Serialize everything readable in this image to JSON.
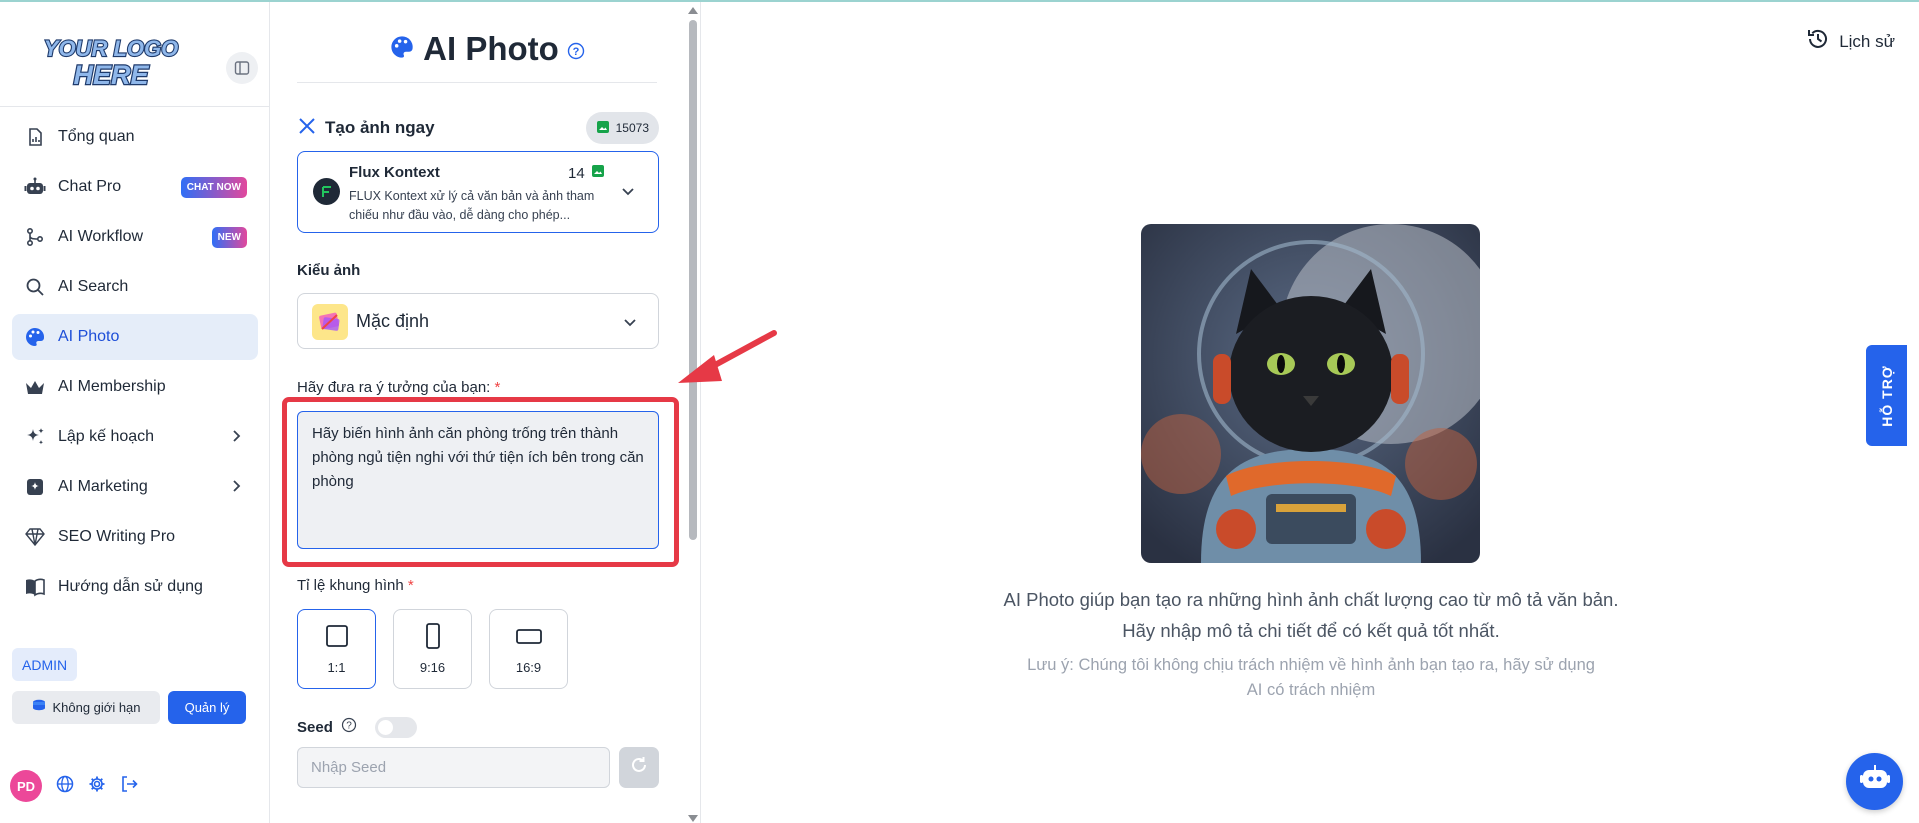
{
  "sidebar": {
    "logo_text": "YOUR LOGO HERE",
    "items": [
      {
        "label": "Tổng quan",
        "icon": "document-chart-icon"
      },
      {
        "label": "Chat Pro",
        "icon": "robot-icon",
        "badge": "CHAT NOW"
      },
      {
        "label": "AI Workflow",
        "icon": "workflow-icon",
        "badge": "NEW"
      },
      {
        "label": "AI Search",
        "icon": "search-icon"
      },
      {
        "label": "AI Photo",
        "icon": "palette-icon",
        "active": true
      },
      {
        "label": "AI Membership",
        "icon": "crown-icon"
      },
      {
        "label": "Lập kế hoạch",
        "icon": "sparkle-icon",
        "has_submenu": true
      },
      {
        "label": "AI Marketing",
        "icon": "marketing-icon",
        "has_submenu": true
      },
      {
        "label": "SEO Writing Pro",
        "icon": "diamond-icon"
      },
      {
        "label": "Hướng dẫn sử dụng",
        "icon": "book-icon"
      }
    ],
    "role_badge": "ADMIN",
    "plan_button": "Không giới hạn",
    "manage_button": "Quản lý",
    "user_initials": "PD"
  },
  "panel": {
    "title": "AI Photo",
    "create_label": "Tạo ảnh ngay",
    "credits": "15073",
    "model": {
      "name": "Flux Kontext",
      "cost": "14",
      "description": "FLUX Kontext xử lý cả văn bản và ảnh tham chiếu như đầu vào, dễ dàng cho phép..."
    },
    "style_label": "Kiểu ảnh",
    "style_value": "Mặc định",
    "prompt_label": "Hãy đưa ra ý tưởng của bạn:",
    "required_mark": "*",
    "prompt_value": "Hãy biến hình ảnh căn phòng trống trên thành phòng ngủ tiện nghi với thứ tiện ích bên trong căn phòng",
    "ratio_label": "Tỉ lệ khung hình",
    "ratios": [
      {
        "label": "1:1",
        "selected": true
      },
      {
        "label": "9:16",
        "selected": false
      },
      {
        "label": "16:9",
        "selected": false
      }
    ],
    "seed_label": "Seed",
    "seed_enabled": false,
    "seed_placeholder": "Nhập Seed"
  },
  "main": {
    "history_label": "Lịch sử",
    "caption": "AI Photo giúp bạn tạo ra những hình ảnh chất lượng cao từ mô tả văn bản. Hãy nhập mô tả chi tiết để có kết quả tốt nhất.",
    "note": "Lưu ý: Chúng tôi không chịu trách nhiệm về hình ảnh bạn tạo ra, hãy sử dụng AI có trách nhiệm",
    "support_label": "HỖ TRỢ"
  },
  "colors": {
    "accent": "#2563eb",
    "highlight": "#e63946",
    "active_bg": "#e5edf9"
  }
}
